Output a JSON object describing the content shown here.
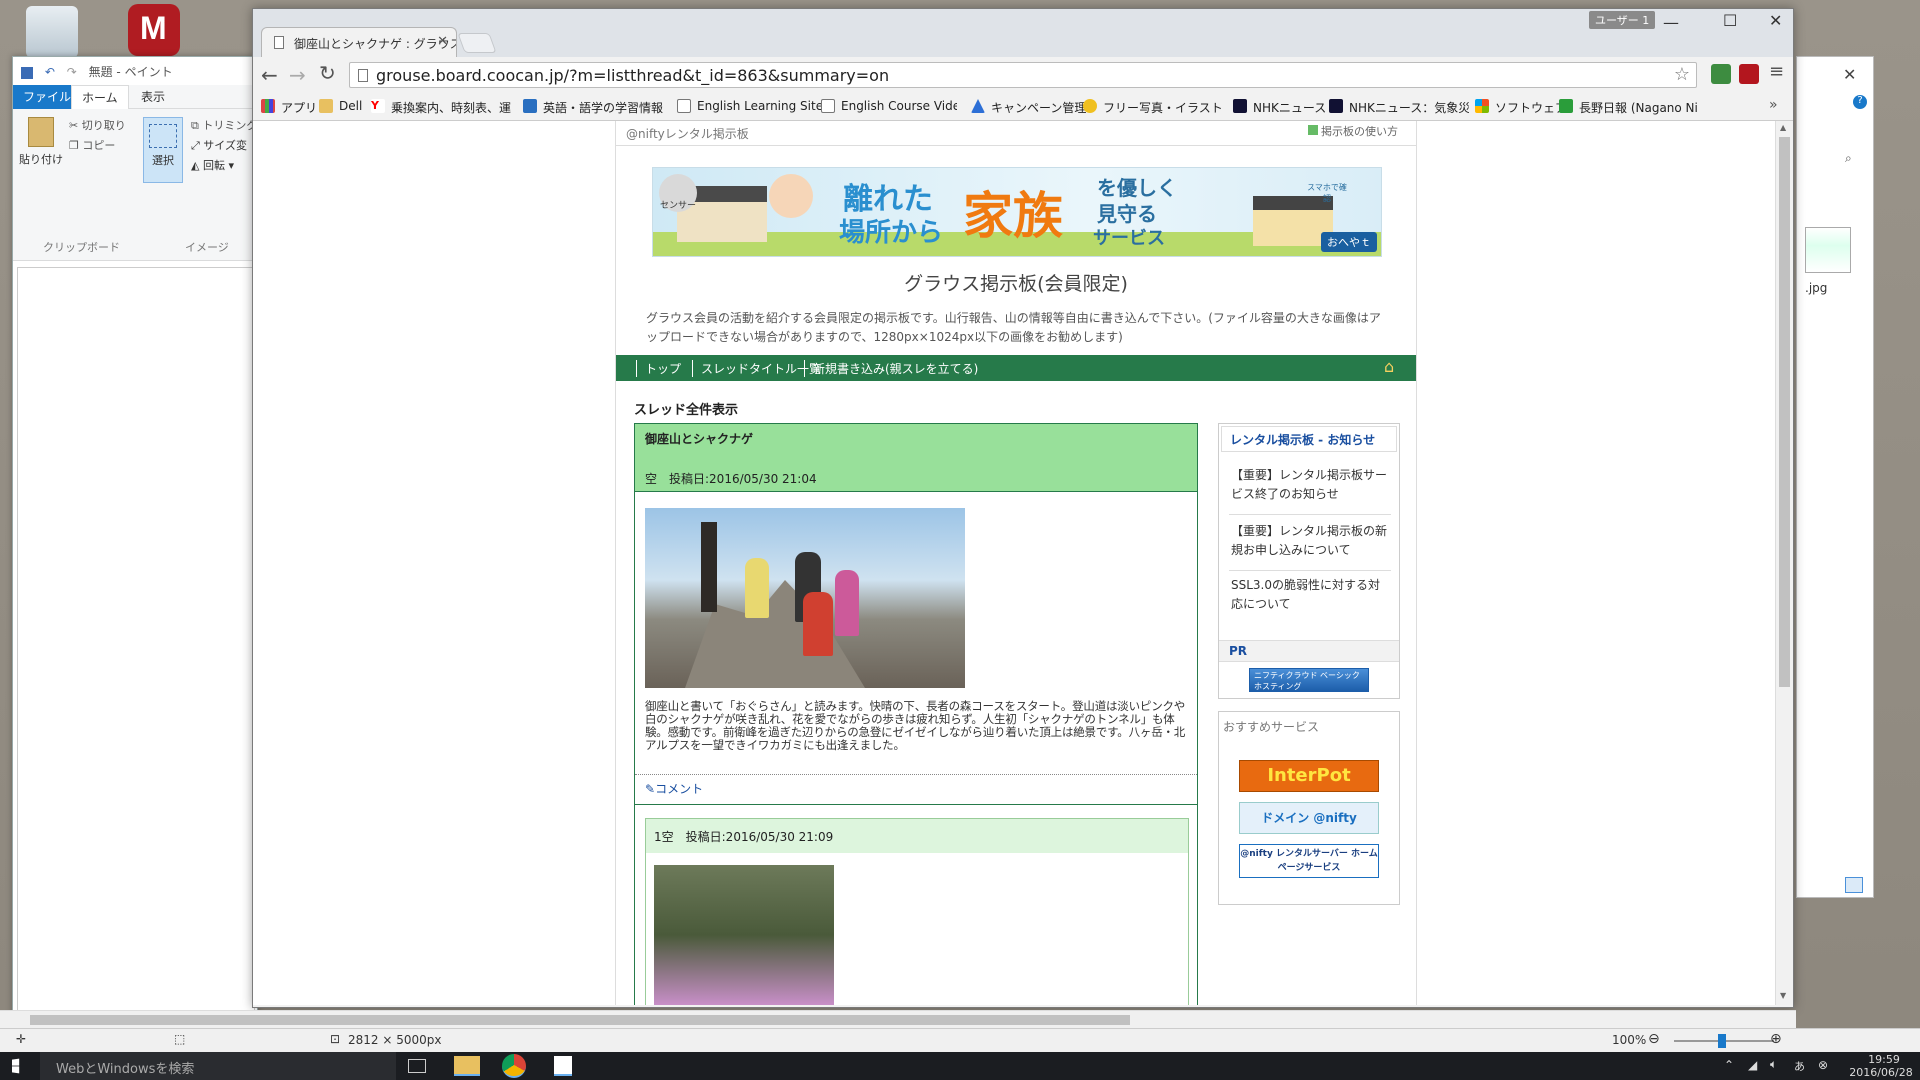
{
  "paint": {
    "title": "無題 - ペイント",
    "tabs": [
      "ファイル",
      "ホーム",
      "表示"
    ],
    "clipboard": {
      "paste": "貼り付け",
      "cut": "切り取り",
      "copy": "コピー",
      "group": "クリップボード"
    },
    "image": {
      "select": "選択",
      "trim": "トリミング",
      "resize": "サイズ変",
      "rotate": "回転",
      "group": "イメージ"
    },
    "status_size": "2812 × 5000px",
    "zoom": "100%"
  },
  "chrome": {
    "user_badge": "ユーザー 1",
    "tab_title": "御座山とシャクナゲ : グラウス",
    "url": "grouse.board.coocan.jp/?m=listthread&t_id=863&summary=on",
    "bookmarks": [
      "アプリ",
      "Dell",
      "乗換案内、時刻表、運",
      "英語・語学の学習情報",
      "English Learning Sites",
      "English Course Video",
      "キャンペーン管理",
      "フリー写真・イラスト素材",
      "NHKニュース",
      "NHKニュース：気象災害",
      "ソフトウェア",
      "長野日報 (Nagano Ni"
    ]
  },
  "board": {
    "brand": "@niftyレンタル掲示板",
    "howto": "掲示板の使い方",
    "banner": {
      "text1": "離れた",
      "text2": "場所から",
      "text3": "家族",
      "text4": "を優しく",
      "text5": "見守る",
      "text6": "サービス",
      "sensor": "センサー",
      "phone": "スマホで確認",
      "logo": "おへやｔ"
    },
    "title": "グラウス掲示板(会員限定)",
    "description": "グラウス会員の活動を紹介する会員限定の掲示板です。山行報告、山の情報等自由に書き込んで下さい。(ファイル容量の大きな画像はアップロードできない場合がありますので、1280px×1024px以下の画像をお勧めします)",
    "nav": [
      "トップ",
      "スレッドタイトル一覧",
      "新規書き込み(親スレを立てる)"
    ],
    "section_title": "スレッド全件表示",
    "thread": {
      "title": "御座山とシャクナゲ",
      "meta": "空　投稿日:2016/05/30 21:04",
      "body": "御座山と書いて「おぐらさん」と読みます。快晴の下、長者の森コースをスタート。登山道は淡いピンクや白のシャクナゲが咲き乱れ、花を愛でながらの歩きは疲れ知らず。人生初「シャクナゲのトンネル」も体験。感動です。前衛峰を過ぎた辺りからの急登にゼイゼイしながら辿り着いた頂上は絶景です。八ヶ岳・北アルプスを一望できイワカガミにも出逢えました。",
      "comment": "コメント"
    },
    "reply": {
      "meta": "1空　投稿日:2016/05/30 21:09"
    },
    "sidebar": {
      "notice_title": "レンタル掲示板 - お知らせ",
      "notices": [
        "【重要】レンタル掲示板サービス終了のお知らせ",
        "【重要】レンタル掲示板の新規お申し込みについて",
        "SSL3.0の脆弱性に対する対応について"
      ],
      "pr": "PR",
      "pr_banner": "ニフティクラウド ベーシックホスティング",
      "recommend_title": "おすすめサービス",
      "rec1": "InterPot",
      "rec2": "ドメイン @nifty",
      "rec3": "@nifty レンタルサーバー ホームページサービス"
    }
  },
  "right_window": {
    "file_label": ".jpg"
  },
  "taskbar": {
    "search": "WebとWindowsを検索",
    "time": "19:59",
    "date": "2016/06/28"
  }
}
